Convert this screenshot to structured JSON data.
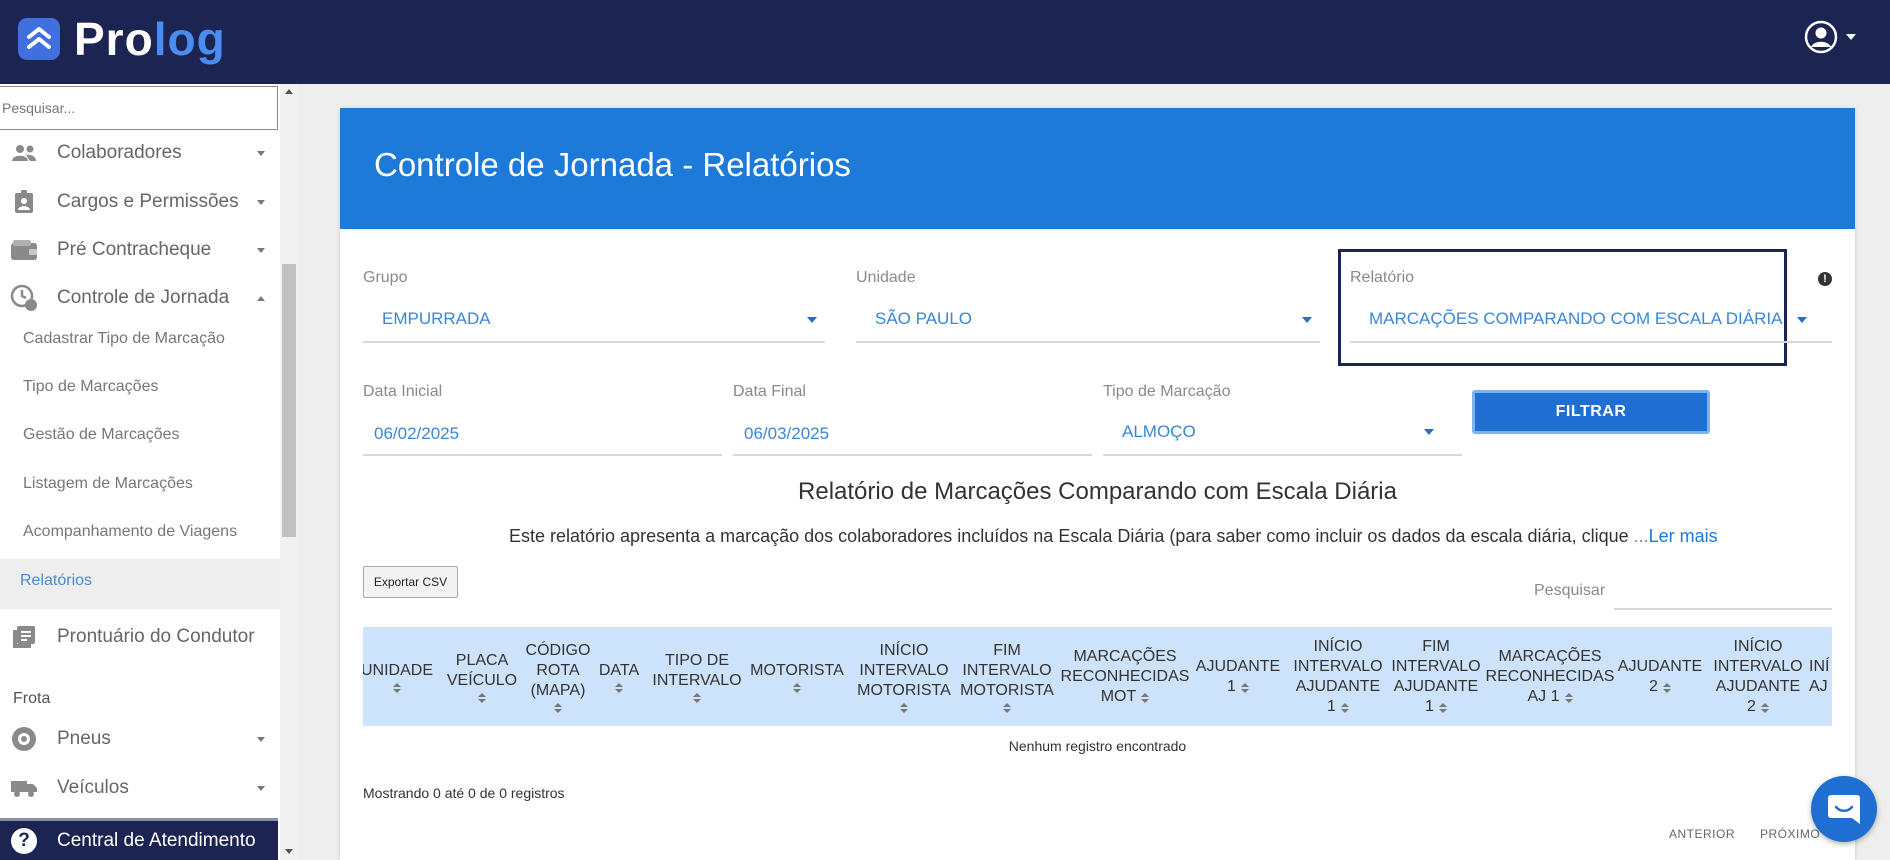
{
  "app": {
    "brand_left": "Pro",
    "brand_right": "log"
  },
  "sidebar": {
    "search_placeholder": "Pesquisar...",
    "items": [
      {
        "label": "Colaboradores",
        "icon": "people-icon"
      },
      {
        "label": "Cargos e Permissões",
        "icon": "badge-icon"
      },
      {
        "label": "Pré Contracheque",
        "icon": "wallet-icon"
      },
      {
        "label": "Controle de Jornada",
        "icon": "clock-icon"
      }
    ],
    "sub_items": [
      "Cadastrar Tipo de Marcação",
      "Tipo de Marcações",
      "Gestão de Marcações",
      "Listagem de Marcações",
      "Acompanhamento de Viagens"
    ],
    "active_sub": "Relatórios",
    "prontuario": "Prontuário do Condutor",
    "section_frota": "Frota",
    "frota_items": [
      {
        "label": "Pneus",
        "icon": "tire-icon"
      },
      {
        "label": "Veículos",
        "icon": "truck-icon"
      }
    ],
    "help": "Central de Atendimento"
  },
  "page": {
    "title": "Controle de Jornada - Relatórios"
  },
  "filters": {
    "grupo": {
      "label": "Grupo",
      "value": "EMPURRADA"
    },
    "unidade": {
      "label": "Unidade",
      "value": "SÃO PAULO"
    },
    "relatorio": {
      "label": "Relatório",
      "value": "MARCAÇÕES COMPARANDO COM ESCALA DIÁRIA"
    },
    "data_inicial": {
      "label": "Data Inicial",
      "value": "06/02/2025"
    },
    "data_final": {
      "label": "Data Final",
      "value": "06/03/2025"
    },
    "tipo_marcacao": {
      "label": "Tipo de Marcação",
      "value": "ALMOÇO"
    },
    "filter_button": "FILTRAR"
  },
  "report": {
    "title": "Relatório de Marcações Comparando com Escala Diária",
    "description": "Este relatório apresenta a marcação dos colaboradores incluídos na Escala Diária (para saber como incluir os dados da escala diária, clique",
    "ellipsis": " ...",
    "read_more": "Ler mais",
    "export_button": "Exportar CSV",
    "search_label": "Pesquisar"
  },
  "table": {
    "columns": [
      [
        "UNIDADE"
      ],
      [
        "PLACA",
        "VEÍCULO"
      ],
      [
        "CÓDIGO",
        "ROTA",
        "(MAPA)"
      ],
      [
        "DATA"
      ],
      [
        "TIPO DE",
        "INTERVALO"
      ],
      [
        "MOTORISTA"
      ],
      [
        "INÍCIO",
        "INTERVALO",
        "MOTORISTA"
      ],
      [
        "FIM",
        "INTERVALO",
        "MOTORISTA"
      ],
      [
        "MARCAÇÕES",
        "RECONHECIDAS",
        "MOT"
      ],
      [
        "AJUDANTE",
        "1"
      ],
      [
        "INÍCIO",
        "INTERVALO",
        "AJUDANTE",
        "1"
      ],
      [
        "FIM",
        "INTERVALO",
        "AJUDANTE",
        "1"
      ],
      [
        "MARCAÇÕES",
        "RECONHECIDAS",
        "AJ 1"
      ],
      [
        "AJUDANTE",
        "2"
      ],
      [
        "INÍCIO",
        "INTERVALO",
        "AJUDANTE",
        "2"
      ],
      [
        "INÍ",
        "AJ"
      ]
    ],
    "empty_message": "Nenhum registro encontrado",
    "info": "Mostrando 0 até 0 de 0 registros",
    "prev": "ANTERIOR",
    "next": "PRÓXIMO"
  },
  "colors": {
    "navbar": "#1c2452",
    "header": "#1e7ad9",
    "accent_text": "#3a86d6",
    "table_head": "#cce3fb"
  }
}
